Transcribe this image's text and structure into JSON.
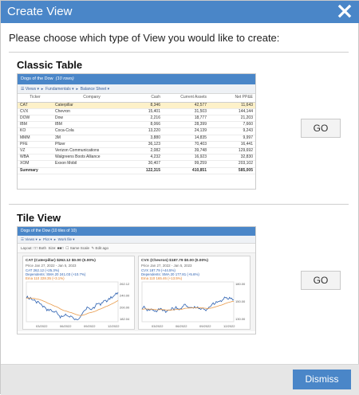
{
  "dialog": {
    "title": "Create View",
    "prompt": "Please choose which type of View you would like to create:",
    "dismiss_label": "Dismiss"
  },
  "colors": {
    "accent": "#4a86c8",
    "highlight": "#fdf1c9",
    "series_blue": "#2a5fb0",
    "series_orange": "#e89a4a"
  },
  "classic": {
    "title": "Classic Table",
    "go_label": "GO",
    "preview": {
      "header_title": "Dogs of the Dow",
      "header_count": "(10 rows)",
      "toolbar": [
        "Views",
        "Fundamentals",
        "Balance Sheet"
      ],
      "columns": [
        "Ticker",
        "Company",
        "Cash",
        "Current Assets",
        "Net PP&E"
      ],
      "rows": [
        [
          "CAT",
          "Caterpillar",
          "8,346",
          "42,577",
          "11,643"
        ],
        [
          "CVX",
          "Chevron",
          "15,401",
          "31,503",
          "144,144"
        ],
        [
          "DOW",
          "Dow",
          "2,216",
          "18,777",
          "21,203"
        ],
        [
          "IBM",
          "IBM",
          "8,066",
          "28,399",
          "7,660"
        ],
        [
          "KO",
          "Coca-Cola",
          "13,220",
          "24,139",
          "9,243"
        ],
        [
          "MMM",
          "3M",
          "3,880",
          "14,835",
          "9,997"
        ],
        [
          "PFE",
          "Pfizer",
          "36,123",
          "70,403",
          "16,441"
        ],
        [
          "VZ",
          "Verizon Communications",
          "2,082",
          "39,748",
          "129,692"
        ],
        [
          "WBA",
          "Walgreens Boots Alliance",
          "4,232",
          "16,923",
          "32,830"
        ],
        [
          "XOM",
          "Exxon Mobil",
          "30,407",
          "99,259",
          "203,102"
        ]
      ],
      "summary": [
        "Summary",
        "",
        "122,315",
        "410,851",
        "585,005"
      ]
    }
  },
  "tile": {
    "title": "Tile View",
    "go_label": "GO",
    "preview": {
      "header_title": "Dogs of the Dow",
      "header_count": "(10 tiles of 10)",
      "toolbar": [
        "Views",
        "Plot",
        "Work file"
      ],
      "layout_bar": [
        "Layout:",
        "Both",
        "Size:",
        "Same Scale",
        "Edit ago"
      ],
      "tiles": [
        {
          "title": "CAT (Caterpillar)  $262.12  $0.00 (0.00%)",
          "subtitle": "Price  Jan 27, 2022 - Jan 5, 2023",
          "line1": "CAT 262.12 (+25.3%)",
          "line2": "Dependents:  SMA 20 241.03 (+10.7%)",
          "line3": "Ema 110 228.35 (+3.1%)",
          "y_ticks": [
            "262.12",
            "240.00",
            "200.00",
            "182.04"
          ],
          "x_ticks": [
            "03/2022",
            "06/2022",
            "09/2022",
            "12/2022"
          ]
        },
        {
          "title": "CVX (Chevron)  $187.79  $0.00 (0.00%)",
          "subtitle": "Price  Jan 27, 2022 - Jan 5, 2023",
          "line1": "CVX 187.79 (+44.5%)",
          "line2": "Dependents:  SMA 20 177.81 (+5.6%)",
          "line3": "Ema 110 165.46 (+13.5%)",
          "y_ticks": [
            "180.00",
            "150.00",
            "130.00"
          ],
          "x_ticks": [
            "03/2022",
            "06/2022",
            "09/2022",
            "12/2022"
          ]
        }
      ]
    }
  }
}
